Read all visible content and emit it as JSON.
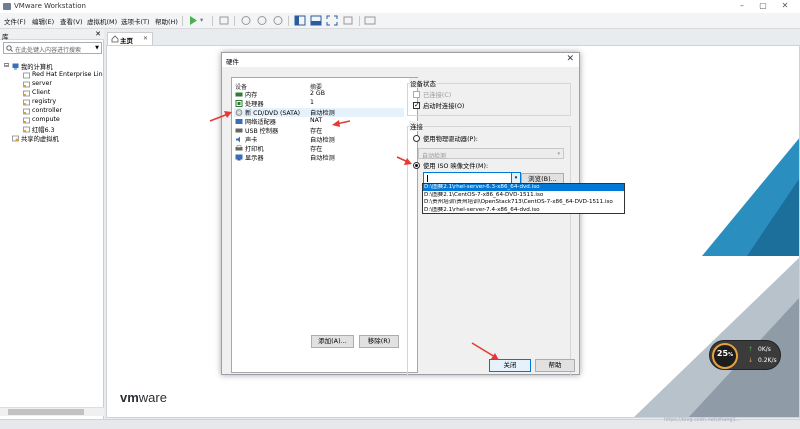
{
  "window": {
    "title": "VMware Workstation",
    "minimize": "–",
    "maximize": "▢",
    "close": "✕"
  },
  "menu": [
    "文件(F)",
    "编辑(E)",
    "查看(V)",
    "虚拟机(M)",
    "选项卡(T)",
    "帮助(H)"
  ],
  "toolbar": {
    "play_dropdown": "▾"
  },
  "library": {
    "title": "库",
    "close": "✕",
    "search_placeholder": "在此处键入内容进行搜索",
    "dropdown": "▼",
    "tree": [
      {
        "label": "我的计算机",
        "level": 0,
        "expander": "⊟"
      },
      {
        "label": "Red Hat Enterprise Lin",
        "level": 1
      },
      {
        "label": "server",
        "level": 1
      },
      {
        "label": "Client",
        "level": 1
      },
      {
        "label": "registry",
        "level": 1
      },
      {
        "label": "controller",
        "level": 1
      },
      {
        "label": "compute",
        "level": 1
      },
      {
        "label": "红帽6.3",
        "level": 1
      },
      {
        "label": "共享的虚拟机",
        "level": 0
      }
    ]
  },
  "tabs": {
    "home": "主页",
    "home_close": "✕"
  },
  "logo": {
    "vm": "vm",
    "ware": "ware"
  },
  "gauge": {
    "value": "25",
    "unit": "%",
    "up": "0K/s",
    "down": "0.2K/s",
    "up_arrow": "↑",
    "down_arrow": "↓"
  },
  "watermark": "https://blog.csdn.net/zhang1...",
  "dialog": {
    "title": "硬件",
    "close": "✕",
    "col_device": "设备",
    "col_summary": "摘要",
    "devices": [
      {
        "name": "内存",
        "summary": "2 GB"
      },
      {
        "name": "处理器",
        "summary": "1"
      },
      {
        "name": "新 CD/DVD (SATA)",
        "summary": "自动检测"
      },
      {
        "name": "网络适配器",
        "summary": "NAT"
      },
      {
        "name": "USB 控制器",
        "summary": "存在"
      },
      {
        "name": "声卡",
        "summary": "自动检测"
      },
      {
        "name": "打印机",
        "summary": "存在"
      },
      {
        "name": "显示器",
        "summary": "自动检测"
      }
    ],
    "add_button": "添加(A)...",
    "remove_button": "移除(R)",
    "device_status": {
      "title": "设备状态",
      "connected": "已连接(C)",
      "connect_on_power": "启动时连接(O)",
      "connect_on_power_mark": "✓"
    },
    "connection": {
      "title": "连接",
      "physical": "使用物理驱动器(P):",
      "physical_value": "自动检测",
      "physical_arrow": "▾",
      "iso": "使用 ISO 映像文件(M):",
      "iso_arrow": "▾",
      "browse": "浏览(B)...",
      "options": [
        "D:\\图赛2.1\\rhel-server-6.3-x86_64-dvd.iso",
        "D:\\图赛2.1\\CentOS-7-x86_64-DVD-1511.iso",
        "D:\\贵州培训\\贵州培训\\OpenStack713\\CentOS-7-x86_64-DVD-1511.iso",
        "D:\\图赛2.1\\rhel-server-7.4-x86_64-dvd.iso"
      ]
    },
    "close_button": "关闭",
    "help_button": "帮助"
  }
}
